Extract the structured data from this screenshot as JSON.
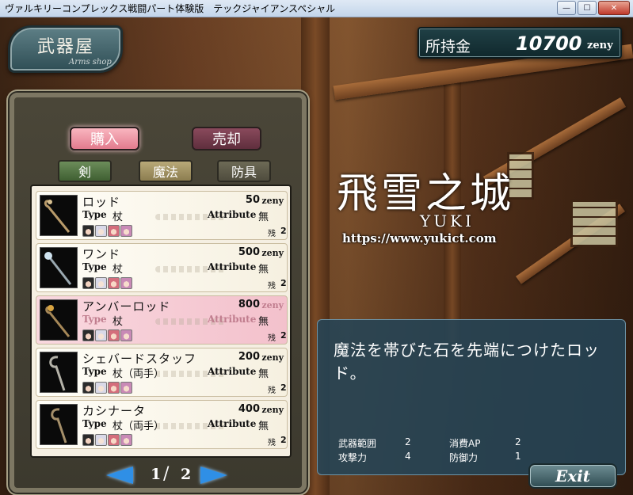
{
  "window": {
    "title": "ヴァルキリーコンプレックス戦闘パート体験版　テックジャイアンスペシャル",
    "minimize_glyph": "—",
    "maximize_glyph": "☐",
    "close_glyph": "✕"
  },
  "shop": {
    "title": "武器屋",
    "subtitle": "Arms shop"
  },
  "money": {
    "label": "所持金",
    "value": "10700",
    "unit": "zeny"
  },
  "mode_tabs": {
    "buy": "購入",
    "sell": "売却"
  },
  "categories": {
    "sword": "剣",
    "magic": "魔法",
    "armor": "防具"
  },
  "labels": {
    "type": "Type",
    "attribute": "Attribute",
    "stock": "残",
    "zeny": "zeny"
  },
  "items": [
    {
      "name": "ロッド",
      "price": "50",
      "type": "杖",
      "attribute": "無",
      "stock": "2"
    },
    {
      "name": "ワンド",
      "price": "500",
      "type": "杖",
      "attribute": "無",
      "stock": "2"
    },
    {
      "name": "アンバーロッド",
      "price": "800",
      "type": "杖",
      "attribute": "無",
      "stock": "2"
    },
    {
      "name": "シェバードスタッフ",
      "price": "200",
      "type": "杖（両手）",
      "attribute": "無",
      "stock": "2"
    },
    {
      "name": "カシナータ",
      "price": "400",
      "type": "杖（両手）",
      "attribute": "無",
      "stock": "2"
    }
  ],
  "pager": {
    "current": "1",
    "slash": "/",
    "total": "2"
  },
  "watermark": {
    "logo": "飛雪之城",
    "yuki": "YUKI",
    "url": "https://www.yukict.com"
  },
  "description": {
    "text": "魔法を帯びた石を先端につけたロッド。",
    "stats": {
      "range_label": "武器範囲",
      "range_value": "2",
      "ap_label": "消費AP",
      "ap_value": "2",
      "atk_label": "攻撃力",
      "atk_value": "4",
      "def_label": "防御力",
      "def_value": "1"
    }
  },
  "exit_label": "Exit"
}
